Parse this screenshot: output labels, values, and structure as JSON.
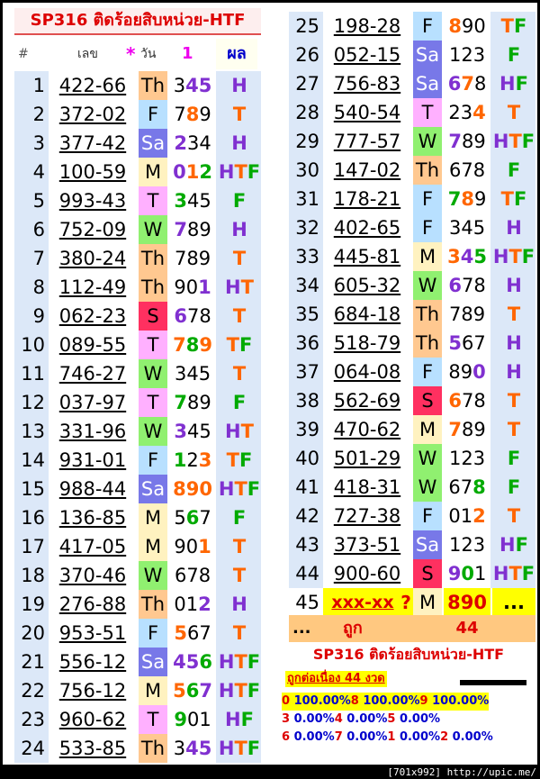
{
  "title": "SP316 ติดร้อยสิบหน่วย-HTF",
  "header": {
    "hash": "#",
    "code": "เลข",
    "star": "*",
    "day": "วัน",
    "one": "1",
    "result": "ผล"
  },
  "colors": {
    "day_Th": "#ffc890",
    "day_F": "#b8e0ff",
    "day_Sa": "#7878e8",
    "day_M": "#fff2c0",
    "day_T": "#ffb0ff",
    "day_W": "#90f070",
    "day_S": "#ff3060",
    "res_H": "#8030d0",
    "res_T": "#ff6600",
    "res_F": "#00aa00",
    "dig_H": "#8030d0",
    "dig_T": "#ff6600",
    "dig_F": "#00aa00"
  },
  "rows": [
    {
      "n": "1",
      "code": "422-66",
      "day": "Th",
      "digits": "345",
      "hl": [
        1,
        2
      ],
      "hlc": [
        "H",
        "H"
      ],
      "res": "H"
    },
    {
      "n": "2",
      "code": "372-02",
      "day": "F",
      "digits": "789",
      "hl": [
        1
      ],
      "hlc": [
        "T"
      ],
      "res": "T"
    },
    {
      "n": "3",
      "code": "377-42",
      "day": "Sa",
      "digits": "234",
      "hl": [
        0
      ],
      "hlc": [
        "H"
      ],
      "res": "H"
    },
    {
      "n": "4",
      "code": "100-59",
      "day": "M",
      "digits": "012",
      "hl": [
        0,
        1,
        2
      ],
      "hlc": [
        "H",
        "T",
        "F"
      ],
      "res": "HTF"
    },
    {
      "n": "5",
      "code": "993-43",
      "day": "T",
      "digits": "345",
      "hl": [
        0
      ],
      "hlc": [
        "F"
      ],
      "res": "F"
    },
    {
      "n": "6",
      "code": "752-09",
      "day": "W",
      "digits": "789",
      "hl": [
        0
      ],
      "hlc": [
        "H"
      ],
      "res": "H"
    },
    {
      "n": "7",
      "code": "380-24",
      "day": "Th",
      "digits": "789",
      "hl": [],
      "hlc": [],
      "res": "T"
    },
    {
      "n": "8",
      "code": "112-49",
      "day": "Th",
      "digits": "901",
      "hl": [
        2
      ],
      "hlc": [
        "H"
      ],
      "res": "HT"
    },
    {
      "n": "9",
      "code": "062-23",
      "day": "S",
      "digits": "678",
      "hl": [
        0
      ],
      "hlc": [
        "H"
      ],
      "res": "T"
    },
    {
      "n": "10",
      "code": "089-55",
      "day": "T",
      "digits": "789",
      "hl": [
        0,
        1,
        2
      ],
      "hlc": [
        "T",
        "F",
        "T"
      ],
      "res": "TF"
    },
    {
      "n": "11",
      "code": "746-27",
      "day": "W",
      "digits": "345",
      "hl": [],
      "hlc": [],
      "res": "T"
    },
    {
      "n": "12",
      "code": "037-97",
      "day": "T",
      "digits": "789",
      "hl": [
        0
      ],
      "hlc": [
        "F"
      ],
      "res": "F"
    },
    {
      "n": "13",
      "code": "331-96",
      "day": "W",
      "digits": "345",
      "hl": [
        0
      ],
      "hlc": [
        "H"
      ],
      "res": "HT"
    },
    {
      "n": "14",
      "code": "931-01",
      "day": "F",
      "digits": "123",
      "hl": [
        0,
        2
      ],
      "hlc": [
        "F",
        "T"
      ],
      "res": "TF"
    },
    {
      "n": "15",
      "code": "988-44",
      "day": "Sa",
      "digits": "890",
      "hl": [
        0,
        1,
        2
      ],
      "hlc": [
        "T",
        "T",
        "T"
      ],
      "res": "HTF"
    },
    {
      "n": "16",
      "code": "136-85",
      "day": "M",
      "digits": "567",
      "hl": [
        1
      ],
      "hlc": [
        "F"
      ],
      "res": "F"
    },
    {
      "n": "17",
      "code": "417-05",
      "day": "M",
      "digits": "901",
      "hl": [
        2
      ],
      "hlc": [
        "T"
      ],
      "res": "T"
    },
    {
      "n": "18",
      "code": "370-46",
      "day": "W",
      "digits": "678",
      "hl": [],
      "hlc": [],
      "res": "T"
    },
    {
      "n": "19",
      "code": "276-88",
      "day": "Th",
      "digits": "012",
      "hl": [
        2
      ],
      "hlc": [
        "H"
      ],
      "res": "H"
    },
    {
      "n": "20",
      "code": "953-51",
      "day": "F",
      "digits": "567",
      "hl": [
        0
      ],
      "hlc": [
        "T"
      ],
      "res": "T"
    },
    {
      "n": "21",
      "code": "556-12",
      "day": "Sa",
      "digits": "456",
      "hl": [
        0,
        1,
        2
      ],
      "hlc": [
        "H",
        "H",
        "F"
      ],
      "res": "HTF"
    },
    {
      "n": "22",
      "code": "756-12",
      "day": "M",
      "digits": "567",
      "hl": [
        0,
        1,
        2
      ],
      "hlc": [
        "T",
        "F",
        "H"
      ],
      "res": "HTF"
    },
    {
      "n": "23",
      "code": "960-62",
      "day": "T",
      "digits": "901",
      "hl": [
        0
      ],
      "hlc": [
        "F"
      ],
      "res": "HF"
    },
    {
      "n": "24",
      "code": "533-85",
      "day": "Th",
      "digits": "345",
      "hl": [
        1,
        2
      ],
      "hlc": [
        "H",
        "H"
      ],
      "res": "HTF"
    },
    {
      "n": "25",
      "code": "198-28",
      "day": "F",
      "digits": "890",
      "hl": [
        0
      ],
      "hlc": [
        "T"
      ],
      "res": "TF"
    },
    {
      "n": "26",
      "code": "052-15",
      "day": "Sa",
      "digits": "123",
      "hl": [],
      "hlc": [],
      "res": "F"
    },
    {
      "n": "27",
      "code": "756-83",
      "day": "Sa",
      "digits": "678",
      "hl": [
        0,
        1
      ],
      "hlc": [
        "H",
        "T"
      ],
      "res": "HF"
    },
    {
      "n": "28",
      "code": "540-54",
      "day": "T",
      "digits": "234",
      "hl": [
        2
      ],
      "hlc": [
        "T"
      ],
      "res": "T"
    },
    {
      "n": "29",
      "code": "777-57",
      "day": "W",
      "digits": "789",
      "hl": [
        0
      ],
      "hlc": [
        "H"
      ],
      "res": "HTF"
    },
    {
      "n": "30",
      "code": "147-02",
      "day": "Th",
      "digits": "678",
      "hl": [],
      "hlc": [],
      "res": "F"
    },
    {
      "n": "31",
      "code": "178-21",
      "day": "F",
      "digits": "789",
      "hl": [
        0,
        1
      ],
      "hlc": [
        "F",
        "T"
      ],
      "res": "TF"
    },
    {
      "n": "32",
      "code": "402-65",
      "day": "F",
      "digits": "345",
      "hl": [],
      "hlc": [],
      "res": "H"
    },
    {
      "n": "33",
      "code": "445-81",
      "day": "M",
      "digits": "345",
      "hl": [
        0,
        1,
        2
      ],
      "hlc": [
        "T",
        "H",
        "F"
      ],
      "res": "HTF"
    },
    {
      "n": "34",
      "code": "605-32",
      "day": "W",
      "digits": "678",
      "hl": [
        0
      ],
      "hlc": [
        "H"
      ],
      "res": "H"
    },
    {
      "n": "35",
      "code": "684-18",
      "day": "Th",
      "digits": "789",
      "hl": [],
      "hlc": [],
      "res": "T"
    },
    {
      "n": "36",
      "code": "518-79",
      "day": "Th",
      "digits": "567",
      "hl": [
        0
      ],
      "hlc": [
        "H"
      ],
      "res": "H"
    },
    {
      "n": "37",
      "code": "064-08",
      "day": "F",
      "digits": "890",
      "hl": [
        2
      ],
      "hlc": [
        "H"
      ],
      "res": "H"
    },
    {
      "n": "38",
      "code": "562-69",
      "day": "S",
      "digits": "678",
      "hl": [
        0
      ],
      "hlc": [
        "T"
      ],
      "res": "T"
    },
    {
      "n": "39",
      "code": "470-62",
      "day": "M",
      "digits": "789",
      "hl": [
        0
      ],
      "hlc": [
        "T"
      ],
      "res": "T"
    },
    {
      "n": "40",
      "code": "501-29",
      "day": "W",
      "digits": "123",
      "hl": [],
      "hlc": [],
      "res": "F"
    },
    {
      "n": "41",
      "code": "418-31",
      "day": "W",
      "digits": "678",
      "hl": [
        2
      ],
      "hlc": [
        "F"
      ],
      "res": "F"
    },
    {
      "n": "42",
      "code": "727-38",
      "day": "F",
      "digits": "012",
      "hl": [
        2
      ],
      "hlc": [
        "T"
      ],
      "res": "T"
    },
    {
      "n": "43",
      "code": "373-51",
      "day": "Sa",
      "digits": "123",
      "hl": [],
      "hlc": [],
      "res": "HF"
    },
    {
      "n": "44",
      "code": "900-60",
      "day": "S",
      "digits": "901",
      "hl": [
        0,
        1
      ],
      "hlc": [
        "H",
        "F"
      ],
      "res": "HTF"
    },
    {
      "n": "45",
      "code": "xxx-xx",
      "q": "?",
      "day": "M",
      "digits": "890",
      "hl": [
        0,
        1,
        2
      ],
      "hlc": [
        "X",
        "X",
        "X"
      ],
      "res": "...",
      "pending": true
    }
  ],
  "summary": {
    "dots": "...",
    "correct": "ถูก",
    "count": "44"
  },
  "legend": {
    "title": "SP316 ติดร้อยสิบหน่วย-HTF",
    "streak": "ถูกต่อเนื่อง 44 งวด",
    "lines": [
      [
        {
          "d": "0",
          "p": "100.00%"
        },
        {
          "d": "8",
          "p": "100.00%"
        },
        {
          "d": "9",
          "p": "100.00%"
        }
      ],
      [
        {
          "d": "3",
          "p": "0.00%"
        },
        {
          "d": "4",
          "p": "0.00%"
        },
        {
          "d": "5",
          "p": "0.00%"
        }
      ],
      [
        {
          "d": "6",
          "p": "0.00%"
        },
        {
          "d": "7",
          "p": "0.00%"
        },
        {
          "d": "1",
          "p": "0.00%"
        },
        {
          "d": "2",
          "p": "0.00%"
        }
      ]
    ]
  },
  "footer": "[701x992] http://upic.me/"
}
